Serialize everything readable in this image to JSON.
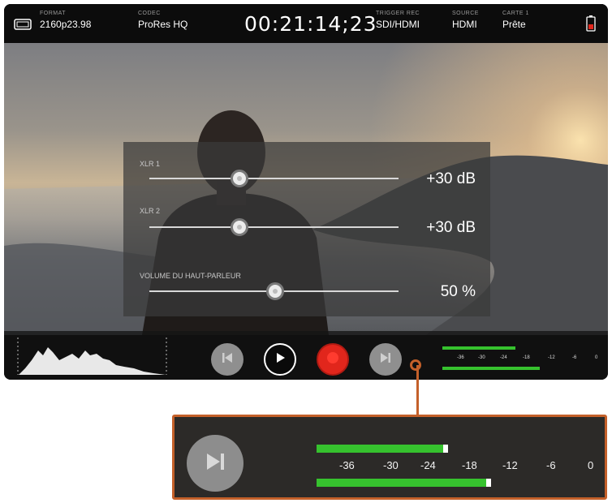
{
  "topbar": {
    "format_label": "FORMAT",
    "format_value": "2160p23.98",
    "codec_label": "CODEC",
    "codec_value": "ProRes HQ",
    "timecode": "00:21:14;23",
    "trigger_label": "TRIGGER REC",
    "trigger_value": "SDI/HDMI",
    "source_label": "SOURCE",
    "source_value": "HDMI",
    "card_label": "CARTE 1",
    "card_value": "Prête",
    "monitor_icon": "monitor-frame-icon",
    "battery_icon": "battery-icon"
  },
  "audio_panel": {
    "channels": [
      {
        "label": "XLR 1",
        "value": "+30 dB",
        "level": 0.36
      },
      {
        "label": "XLR 2",
        "value": "+30 dB",
        "level": 0.36
      },
      {
        "label": "VOLUME DU HAUT-PARLEUR",
        "value": "50 %",
        "level": 0.5
      }
    ]
  },
  "transport": {
    "icons": [
      "skip-back-icon",
      "play-icon",
      "record-icon",
      "skip-forward-icon"
    ]
  },
  "meters": {
    "ticks": [
      "-36",
      "-30",
      "-24",
      "-18",
      "-12",
      "-6",
      "0"
    ],
    "channel1_level": 0.34,
    "channel2_level": 0.45,
    "ok_color": "#36c22e"
  },
  "colors": {
    "accent_callout": "#c4602a",
    "record_red": "#e1261c"
  }
}
